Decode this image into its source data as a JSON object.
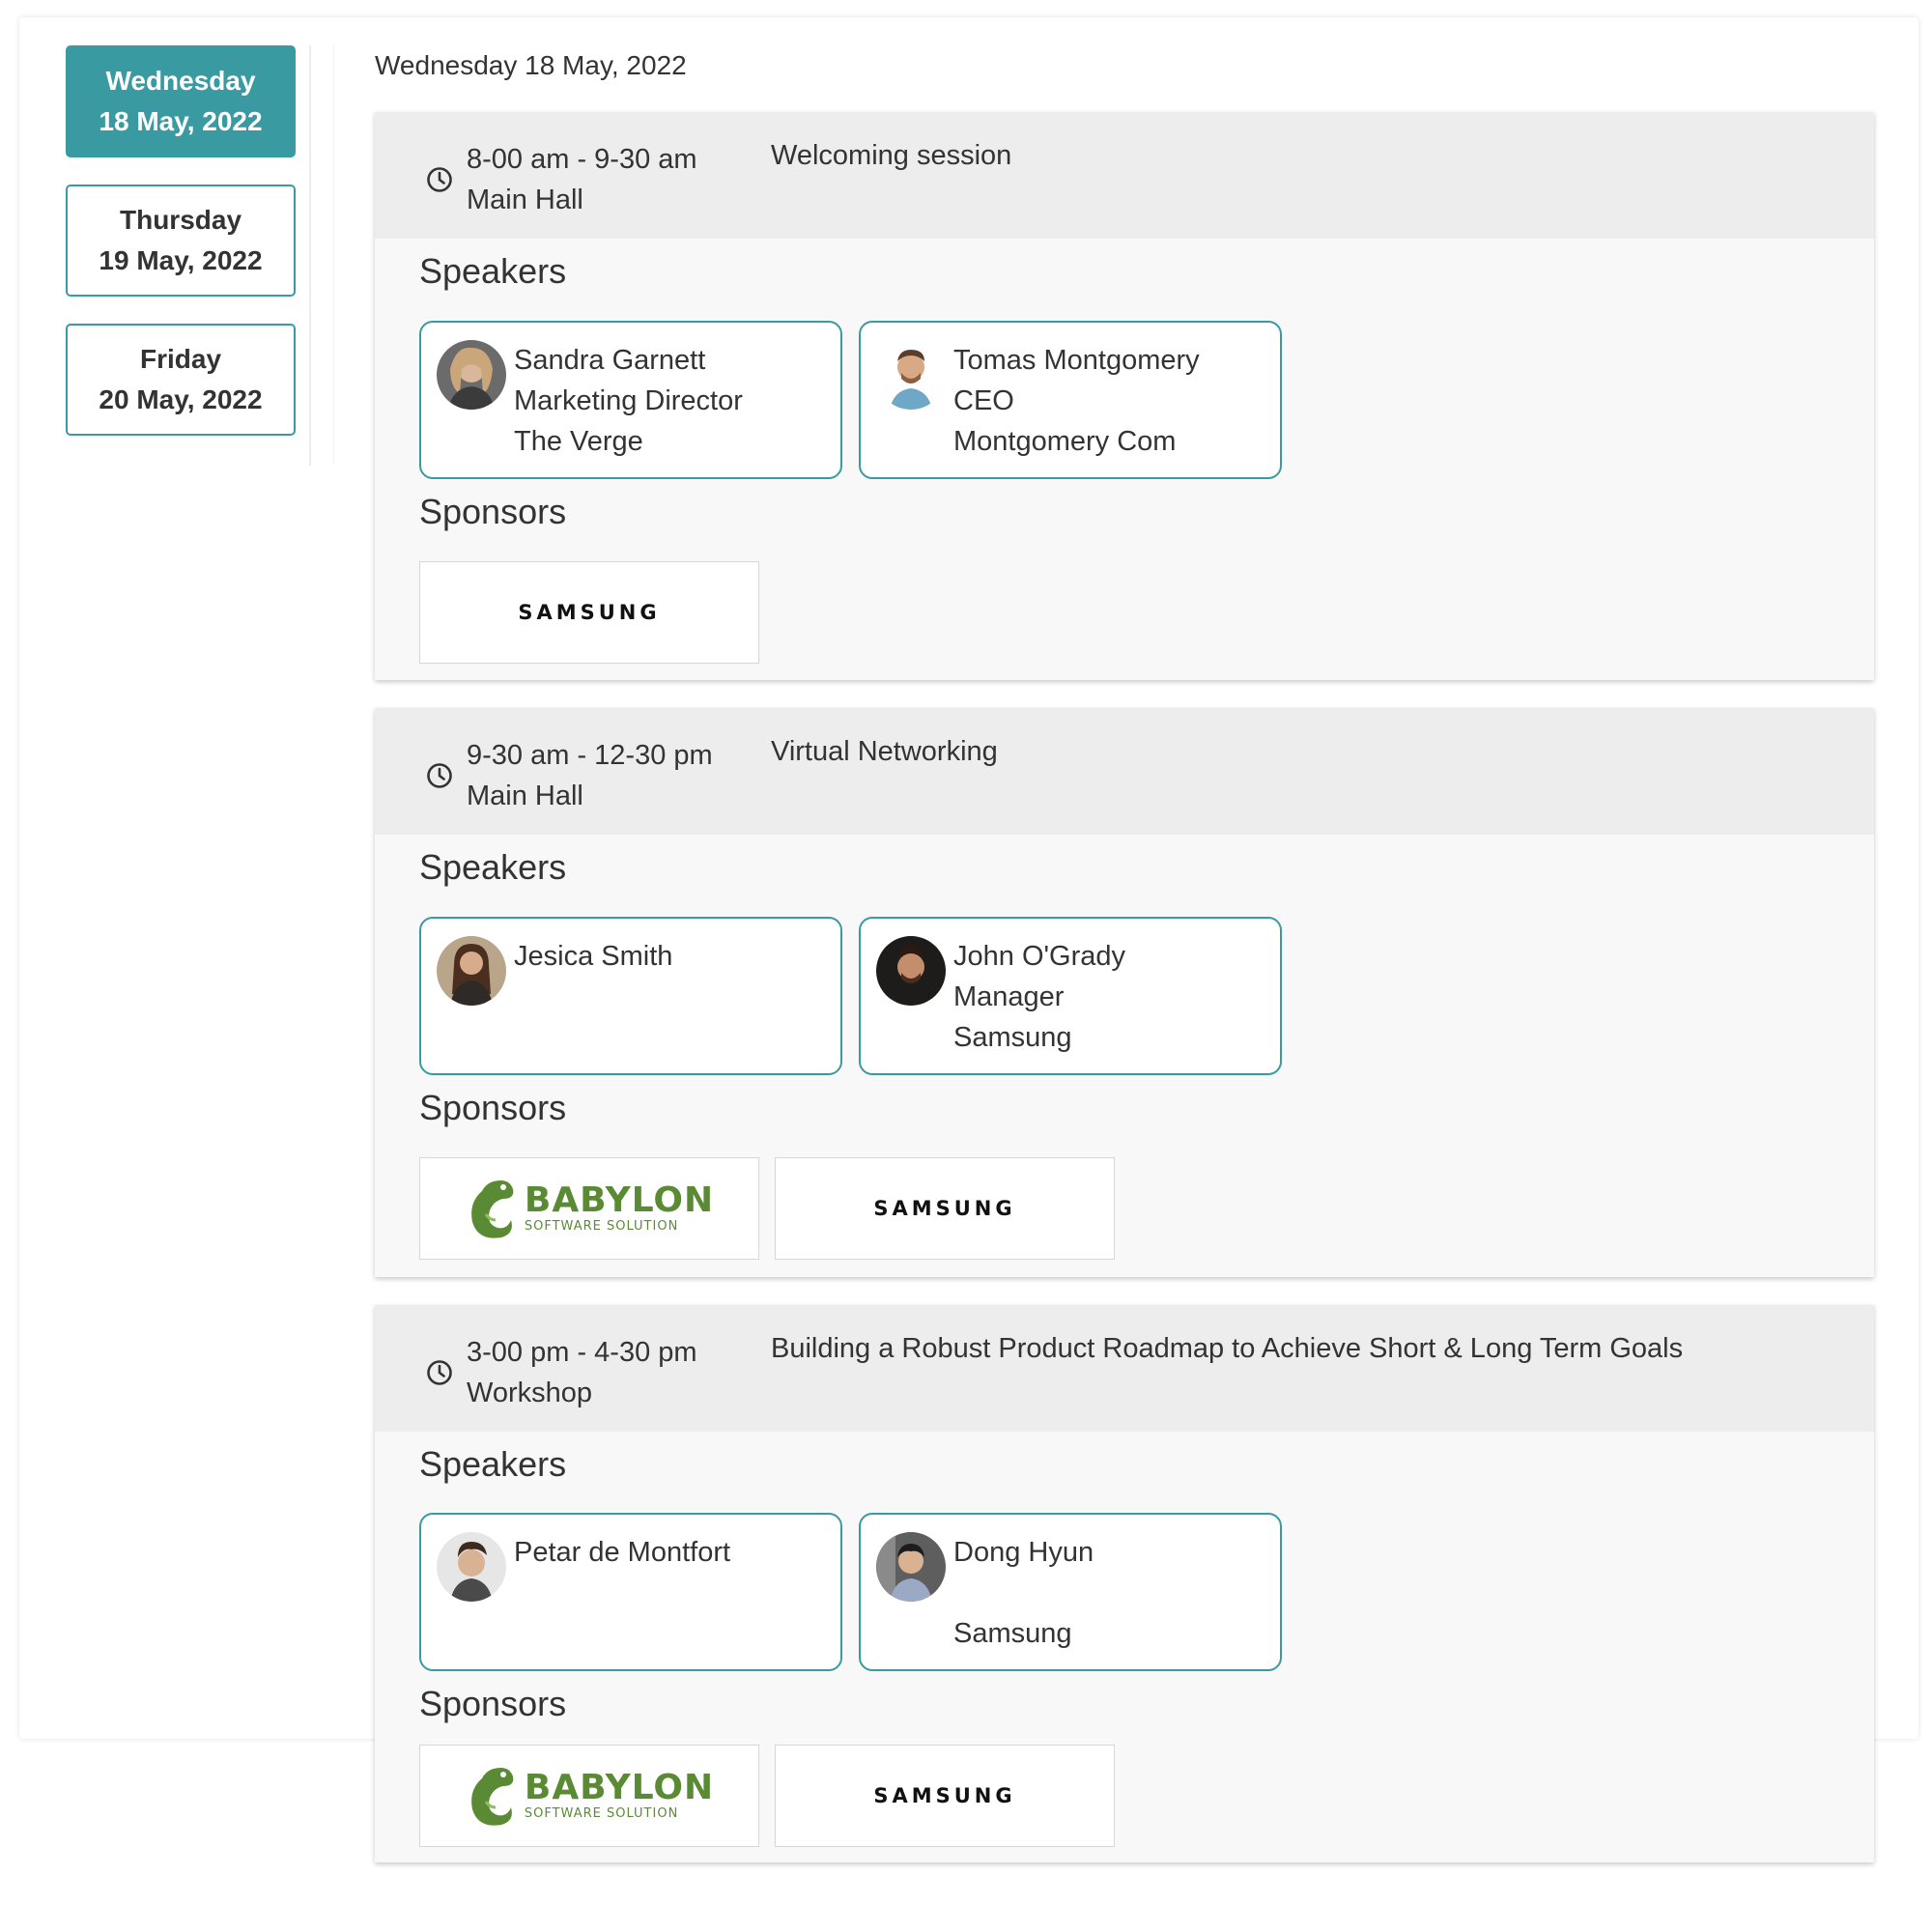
{
  "days": [
    {
      "weekday": "Wednesday",
      "date": "18 May, 2022",
      "active": true
    },
    {
      "weekday": "Thursday",
      "date": "19 May, 2022",
      "active": false
    },
    {
      "weekday": "Friday",
      "date": "20 May, 2022",
      "active": false
    }
  ],
  "main": {
    "heading": "Wednesday 18 May, 2022"
  },
  "labels": {
    "speakers": "Speakers",
    "sponsors": "Sponsors"
  },
  "sessions": [
    {
      "time": "8-00 am - 9-30 am",
      "location": "Main Hall",
      "title": "Welcoming session",
      "speakers": [
        {
          "name": "Sandra Garnett",
          "role": "Marketing Director",
          "company": "The Verge"
        },
        {
          "name": "Tomas Montgomery",
          "role": "CEO",
          "company": "Montgomery Com"
        }
      ],
      "sponsors": [
        "SAMSUNG"
      ]
    },
    {
      "time": "9-30 am - 12-30 pm",
      "location": "Main Hall",
      "title": "Virtual Networking",
      "speakers": [
        {
          "name": "Jesica Smith",
          "role": "",
          "company": ""
        },
        {
          "name": "John O'Grady",
          "role": "Manager",
          "company": "Samsung"
        }
      ],
      "sponsors": [
        "BABYLON",
        "SAMSUNG"
      ]
    },
    {
      "time": "3-00 pm - 4-30 pm",
      "location": "Workshop",
      "title": "Building a Robust Product Roadmap to Achieve Short & Long Term Goals",
      "speakers": [
        {
          "name": "Petar de Montfort",
          "role": "",
          "company": ""
        },
        {
          "name": "Dong Hyun",
          "role": "",
          "company": "Samsung"
        }
      ],
      "sponsors": [
        "BABYLON",
        "SAMSUNG"
      ]
    }
  ],
  "logos": {
    "samsung": "SAMSUNG",
    "babylon_main": "BABYLON",
    "babylon_sub": "SOFTWARE SOLUTION"
  },
  "colors": {
    "accent": "#3a9aa1",
    "header_bg": "#ededed",
    "babylon_green": "#5a8b34"
  },
  "icons": {
    "session_time": "clock-icon"
  }
}
